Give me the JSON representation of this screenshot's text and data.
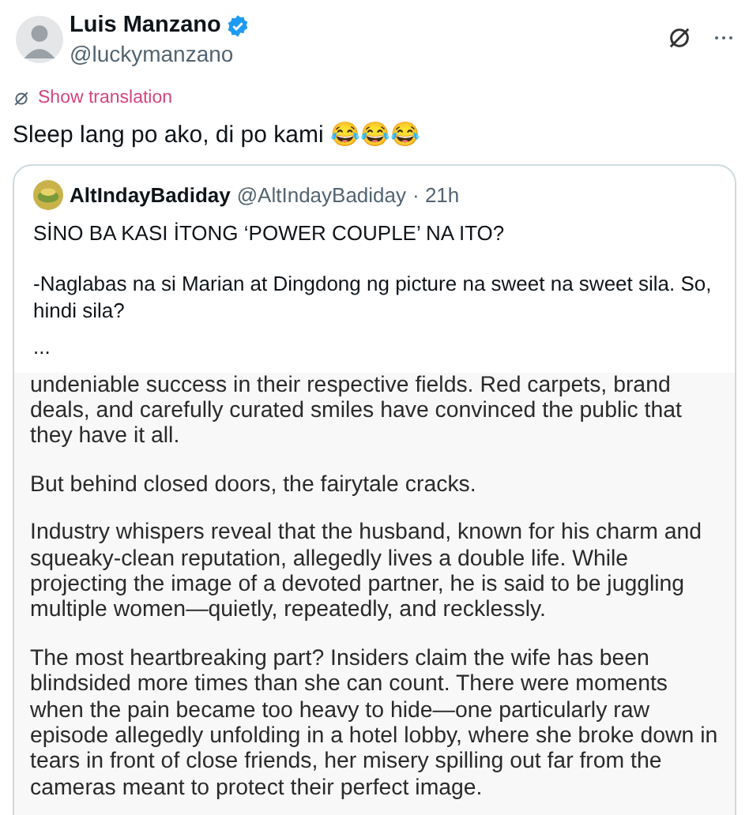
{
  "author": {
    "name": "Luis Manzano",
    "verified": true,
    "handle": "@luckymanzano"
  },
  "translation_link": "Show translation",
  "text": "Sleep lang po ako, di po kami 😂😂😂",
  "quote": {
    "author": {
      "name": "AltIndayBadiday",
      "handle": "@AltIndayBadiday",
      "time": "· 21h"
    },
    "paragraphs": [
      "SİNO BA KASI İTONG ‘POWER COUPLE’ NA ITO?",
      "-Naglabas na si Marian at Dingdong ng picture na sweet na sweet sila. So, hindi sila?",
      "..."
    ],
    "article": [
      "undeniable success in their respective fields. Red carpets, brand deals, and carefully curated smiles have convinced the public that they have it all.",
      "But behind closed doors, the fairytale cracks.",
      "Industry whispers reveal that the husband, known for his charm and squeaky-clean reputation, allegedly lives a double life. While projecting the image of a devoted partner, he is said to be juggling multiple women—quietly, repeatedly, and recklessly.",
      "The most heartbreaking part? Insiders claim the wife has been blindsided more times than she can count. There were moments when the pain became too heavy to hide—one particularly raw episode allegedly unfolding in a hotel lobby, where she broke down in tears in front of close friends, her misery spilling out far from the cameras meant to protect their perfect image."
    ]
  }
}
